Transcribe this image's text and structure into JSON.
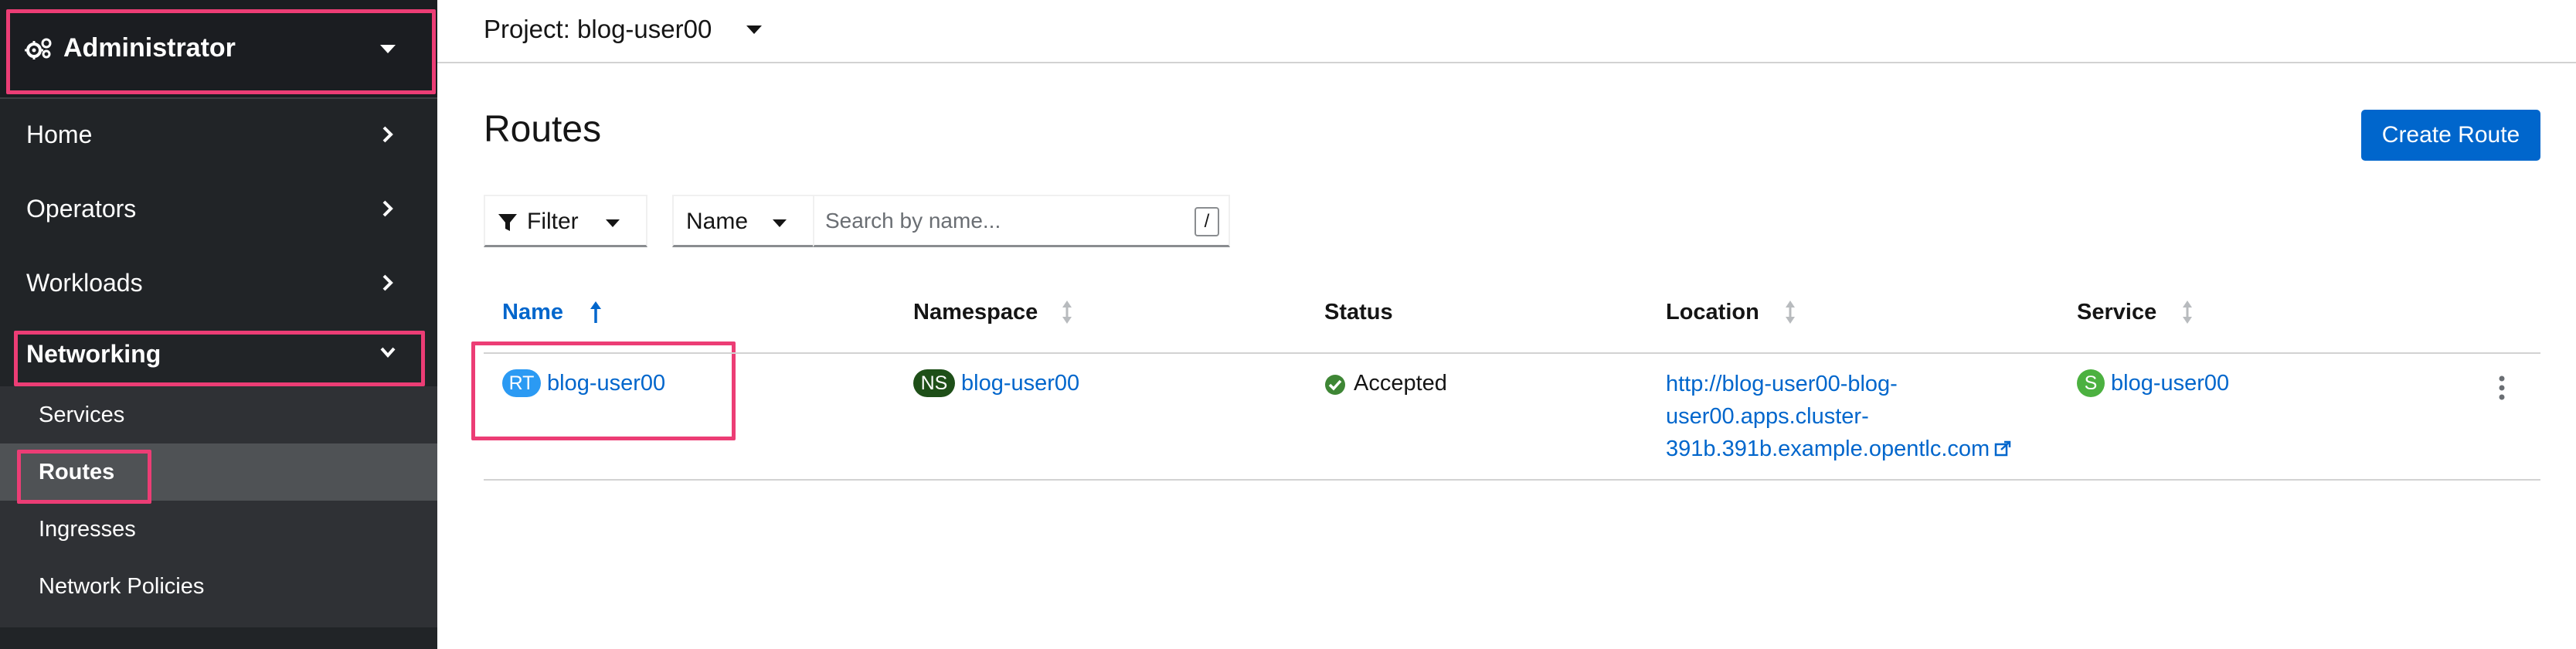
{
  "sidebar": {
    "perspective": {
      "label": "Administrator",
      "icon": "gears-icon"
    },
    "nav": [
      {
        "label": "Home",
        "icon": "chevron-right-icon"
      },
      {
        "label": "Operators",
        "icon": "chevron-right-icon"
      },
      {
        "label": "Workloads",
        "icon": "chevron-right-icon"
      },
      {
        "label": "Networking",
        "icon": "chevron-down-icon",
        "expanded": true
      }
    ],
    "networking_items": [
      "Services",
      "Routes",
      "Ingresses",
      "Network Policies"
    ],
    "current_item": "Routes"
  },
  "header": {
    "project_label": "Project: blog-user00"
  },
  "page": {
    "title": "Routes",
    "create_button": "Create Route"
  },
  "toolbar": {
    "filter_label": "Filter",
    "name_select": "Name",
    "search_placeholder": "Search by name...",
    "shortcut_key": "/"
  },
  "table": {
    "columns": [
      "Name",
      "Namespace",
      "Status",
      "Location",
      "Service"
    ],
    "sorted_column": "Name",
    "sort_direction": "ascending",
    "rows": [
      {
        "name_badge": "RT",
        "name": "blog-user00",
        "namespace_badge": "NS",
        "namespace": "blog-user00",
        "status": "Accepted",
        "location_lines": [
          "http://blog-user00-blog-",
          "user00.apps.cluster-",
          "391b.391b.example.opentlc.com"
        ],
        "service_badge": "S",
        "service": "blog-user00"
      }
    ]
  },
  "colors": {
    "accent": "#0066cc",
    "highlight": "#ec3d75",
    "sidebar_bg": "#212427",
    "route_badge": "#2b9af3",
    "namespace_badge": "#1e4f18",
    "service_badge": "#4cb140",
    "status_ok": "#3e8635"
  }
}
